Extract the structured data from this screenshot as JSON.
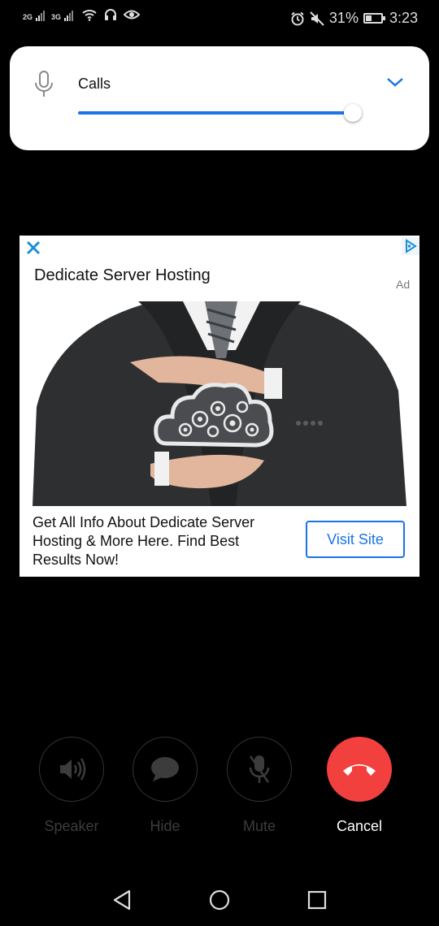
{
  "status_bar": {
    "network_1": "2G",
    "network_2": "3G",
    "battery_percent": "31%",
    "time": "3:23",
    "icons": [
      "signal-icon",
      "wifi-icon",
      "headset-icon",
      "eye-icon",
      "alarm-icon",
      "mute-icon",
      "battery-icon"
    ]
  },
  "volume_panel": {
    "label": "Calls",
    "level": 0.94,
    "accent": "#1a73e8"
  },
  "ad": {
    "title": "Dedicate Server Hosting",
    "badge": "Ad",
    "body": "Get All Info About Dedicate Server Hosting & More Here. Find Best Results Now!",
    "cta": "Visit Site"
  },
  "call_controls": {
    "speaker": "Speaker",
    "hide": "Hide",
    "mute": "Mute",
    "cancel": "Cancel",
    "end_color": "#f2403f"
  },
  "nav": {
    "icons": [
      "back-icon",
      "home-icon",
      "recents-icon"
    ]
  }
}
